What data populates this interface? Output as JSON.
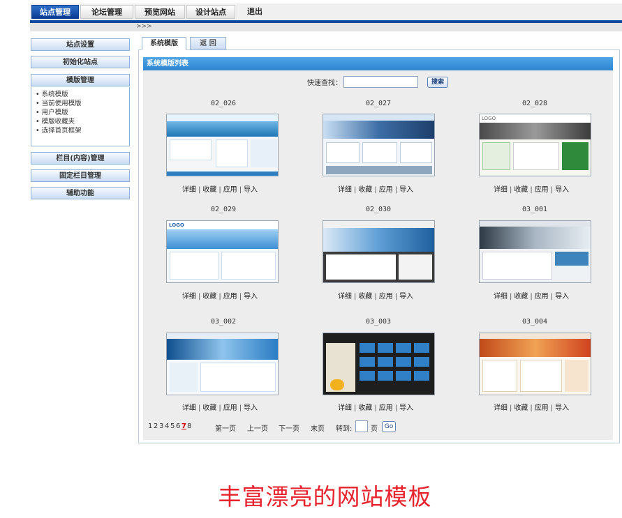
{
  "topnav": {
    "tabs": [
      {
        "label": "站点管理",
        "active": true
      },
      {
        "label": "论坛管理"
      },
      {
        "label": "预览网站"
      },
      {
        "label": "设计站点"
      }
    ],
    "logout": "退出"
  },
  "breadcrumb": ">>>",
  "sidebar": {
    "site_settings": "站点设置",
    "init_site": "初始化站点",
    "template_mgmt": "模版管理",
    "template_items": [
      "系统模版",
      "当前使用模版",
      "用户模版",
      "模版收藏夹",
      "选择首页框架"
    ],
    "column_mgmt": "栏目(内容)管理",
    "fixed_column_mgmt": "固定栏目管理",
    "aux_functions": "辅助功能"
  },
  "panel": {
    "tab_active": "系统模版",
    "tab_back": "返 回",
    "header": "系统模版列表",
    "search_label": "快速查找：",
    "search_value": "",
    "search_button": "搜索"
  },
  "templates": [
    {
      "name": "02_026"
    },
    {
      "name": "02_027"
    },
    {
      "name": "02_028"
    },
    {
      "name": "02_029"
    },
    {
      "name": "02_030"
    },
    {
      "name": "03_001"
    },
    {
      "name": "03_002"
    },
    {
      "name": "03_003"
    },
    {
      "name": "03_004"
    }
  ],
  "template_actions": {
    "detail": "详细",
    "collect": "收藏",
    "apply": "应用",
    "import": "导入"
  },
  "pagination": {
    "pages": [
      "1",
      "2",
      "3",
      "4",
      "5",
      "6",
      "7",
      "8"
    ],
    "current_page": "7",
    "first": "第一页",
    "prev": "上一页",
    "next": "下一页",
    "last": "末页",
    "goto_label": "转到:",
    "page_unit": "页",
    "go_button": "Go"
  },
  "thumbnail_logo": "LOGO",
  "caption": "丰富漂亮的网站模板",
  "colors": {
    "nav_active": "#0a3d93",
    "header_bar": "#2e86d2",
    "caption": "#e8232d",
    "current_page": "#d40000"
  }
}
